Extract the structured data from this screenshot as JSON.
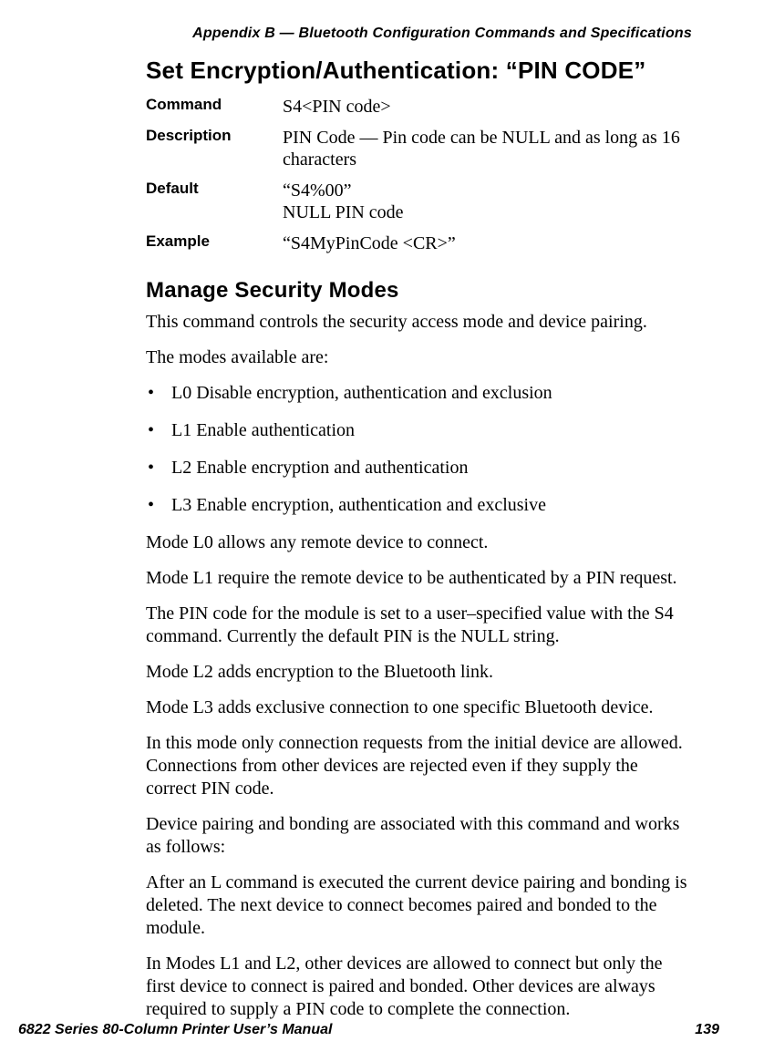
{
  "header": {
    "running_head": "Appendix B — Bluetooth Configuration Commands and Specifications"
  },
  "section1": {
    "title": "Set Encryption/Authentication: “PIN CODE”",
    "rows": {
      "command": {
        "label": "Command",
        "value": "S4<PIN code>"
      },
      "description": {
        "label": "Description",
        "value": "PIN Code — Pin code can be NULL and as long as 16 characters"
      },
      "default": {
        "label": "Default",
        "value_line1": "“S4%00”",
        "value_line2": "NULL PIN code"
      },
      "example": {
        "label": "Example",
        "value": "“S4MyPinCode <CR>”"
      }
    }
  },
  "section2": {
    "title": "Manage Security Modes",
    "p1": "This command controls the security access mode and device pairing.",
    "p2": "The modes available are:",
    "bullets": [
      "L0 Disable encryption, authentication and exclusion",
      "L1 Enable authentication",
      "L2 Enable encryption and authentication",
      "L3 Enable encryption, authentication and exclusive"
    ],
    "p3": "Mode L0 allows any remote device to connect.",
    "p4": "Mode L1 require the remote device to be authenticated by a PIN request.",
    "p5": "The PIN code for the module is set to a user–specified value with the S4 command. Currently the default PIN is the NULL string.",
    "p6": "Mode L2 adds encryption to the Bluetooth link.",
    "p7": "Mode L3 adds exclusive connection to one specific Bluetooth device.",
    "p8": "In this mode only connection requests from the initial device are allowed. Connections from other devices are rejected even if they supply the correct PIN code.",
    "p9": "Device pairing and bonding are associated with this command and works as follows:",
    "p10": "After an L command is executed the current device pairing and bonding is deleted. The next device to connect becomes paired and bonded to the module.",
    "p11": "In Modes L1 and L2, other devices are allowed to connect but only the first device to connect is paired and bonded. Other devices are always required to supply a PIN code to complete the connection."
  },
  "footer": {
    "left": "6822 Series 80-Column Printer User’s Manual",
    "right": "139"
  }
}
